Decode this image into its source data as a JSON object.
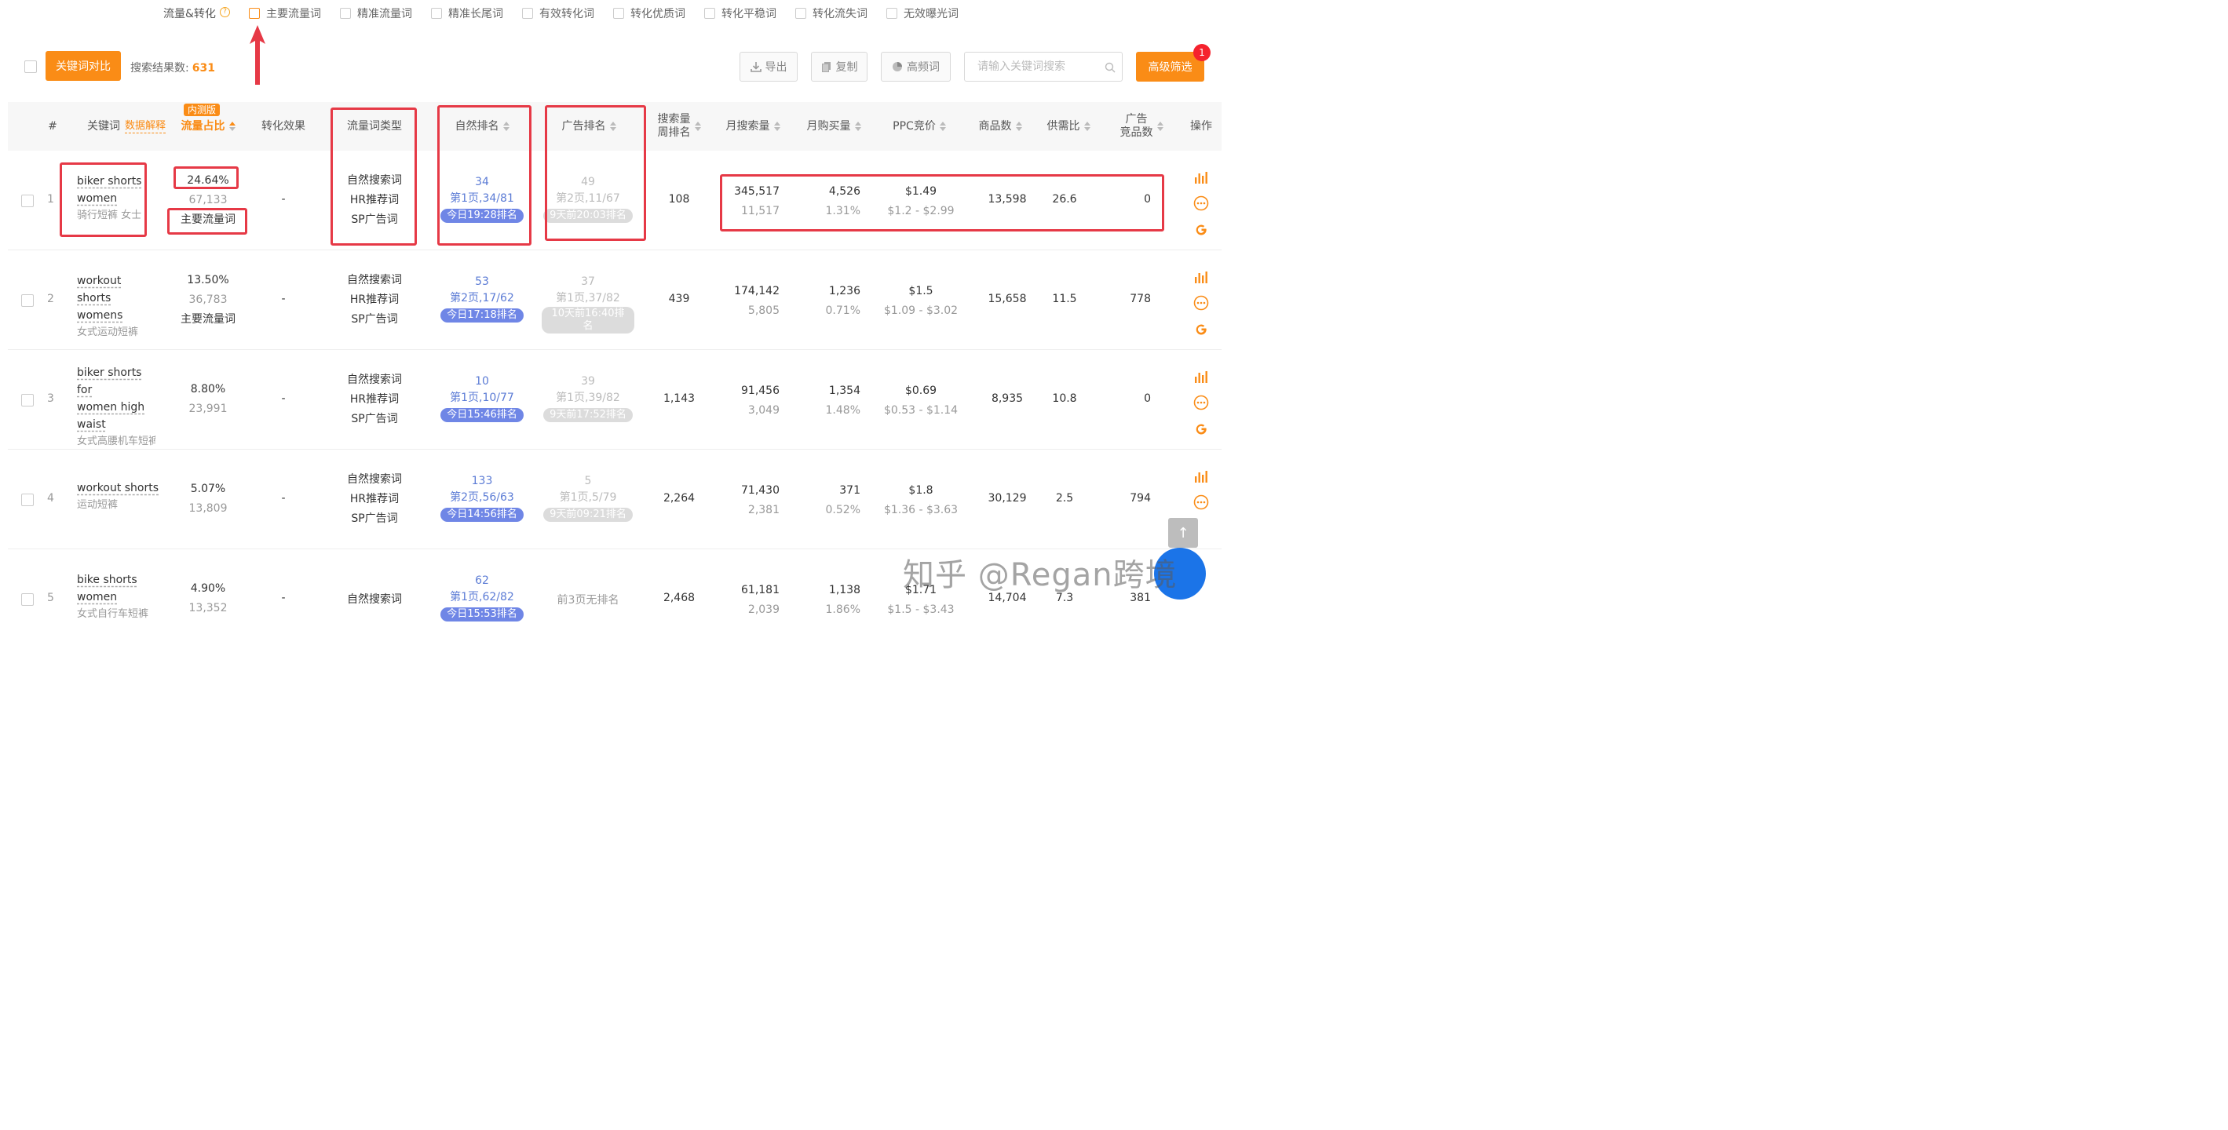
{
  "filters": {
    "title": "流量&转化",
    "help": "?",
    "options": [
      "主要流量词",
      "精准流量词",
      "精准长尾词",
      "有效转化词",
      "转化优质词",
      "转化平稳词",
      "转化流失词",
      "无效曝光词"
    ]
  },
  "toolbar": {
    "compare_label": "关键词对比",
    "result_label": "搜索结果数:",
    "result_count": "631",
    "export_label": "导出",
    "copy_label": "复制",
    "freq_label": "高频词",
    "search_placeholder": "请输入关键词搜索",
    "advanced_label": "高级筛选",
    "badge": "1"
  },
  "table": {
    "headers": {
      "index": "#",
      "keyword": "关键词",
      "data_explain": "数据解释",
      "beta": "内测版",
      "traffic_share": "流量占比",
      "conversion": "转化效果",
      "traffic_type": "流量词类型",
      "natural_rank": "自然排名",
      "ad_rank": "广告排名",
      "search_rank_1": "搜索量",
      "search_rank_2": "周排名",
      "monthly_search": "月搜索量",
      "monthly_purchase": "月购买量",
      "ppc": "PPC竞价",
      "products": "商品数",
      "supply_ratio": "供需比",
      "ad_products_1": "广告",
      "ad_products_2": "竞品数",
      "ops": "操作"
    },
    "rows": [
      {
        "idx": "1",
        "kw_en": [
          "biker shorts",
          "women"
        ],
        "kw_cn": "骑行短裤 女士",
        "share": "24.64%",
        "share_count": "67,133",
        "share_tag": "主要流量词",
        "conversion": "-",
        "types": [
          "自然搜索词",
          "HR推荐词",
          "SP广告词"
        ],
        "nat_rank": "34",
        "nat_page": "第1页,34/81",
        "nat_time": "今日19:28排名",
        "ad_rank": "49",
        "ad_page": "第2页,11/67",
        "ad_time": "9天前20:03排名",
        "search_week": "108",
        "monthly_search": "345,517",
        "monthly_search_sub": "11,517",
        "monthly_buy": "4,526",
        "monthly_buy_rate": "1.31%",
        "ppc": "$1.49",
        "ppc_range": "$1.2 - $2.99",
        "products": "13,598",
        "supply": "26.6",
        "ad_products": "0"
      },
      {
        "idx": "2",
        "kw_en": [
          "workout shorts",
          "womens"
        ],
        "kw_cn": "女式运动短裤",
        "share": "13.50%",
        "share_count": "36,783",
        "share_tag": "主要流量词",
        "conversion": "-",
        "types": [
          "自然搜索词",
          "HR推荐词",
          "SP广告词"
        ],
        "nat_rank": "53",
        "nat_page": "第2页,17/62",
        "nat_time": "今日17:18排名",
        "ad_rank": "37",
        "ad_page": "第1页,37/82",
        "ad_time": "10天前16:40排名",
        "search_week": "439",
        "monthly_search": "174,142",
        "monthly_search_sub": "5,805",
        "monthly_buy": "1,236",
        "monthly_buy_rate": "0.71%",
        "ppc": "$1.5",
        "ppc_range": "$1.09 - $3.02",
        "products": "15,658",
        "supply": "11.5",
        "ad_products": "778"
      },
      {
        "idx": "3",
        "kw_en": [
          "biker shorts for",
          "women high",
          "waist"
        ],
        "kw_cn": "女式高腰机车短裤",
        "share": "8.80%",
        "share_count": "23,991",
        "share_tag": "",
        "conversion": "-",
        "types": [
          "自然搜索词",
          "HR推荐词",
          "SP广告词"
        ],
        "nat_rank": "10",
        "nat_page": "第1页,10/77",
        "nat_time": "今日15:46排名",
        "ad_rank": "39",
        "ad_page": "第1页,39/82",
        "ad_time": "9天前17:52排名",
        "search_week": "1,143",
        "monthly_search": "91,456",
        "monthly_search_sub": "3,049",
        "monthly_buy": "1,354",
        "monthly_buy_rate": "1.48%",
        "ppc": "$0.69",
        "ppc_range": "$0.53 - $1.14",
        "products": "8,935",
        "supply": "10.8",
        "ad_products": "0"
      },
      {
        "idx": "4",
        "kw_en": [
          "workout shorts"
        ],
        "kw_cn": "运动短裤",
        "share": "5.07%",
        "share_count": "13,809",
        "share_tag": "",
        "conversion": "-",
        "types": [
          "自然搜索词",
          "HR推荐词",
          "SP广告词"
        ],
        "nat_rank": "133",
        "nat_page": "第2页,56/63",
        "nat_time": "今日14:56排名",
        "ad_rank": "5",
        "ad_page": "第1页,5/79",
        "ad_time": "9天前09:21排名",
        "search_week": "2,264",
        "monthly_search": "71,430",
        "monthly_search_sub": "2,381",
        "monthly_buy": "371",
        "monthly_buy_rate": "0.52%",
        "ppc": "$1.8",
        "ppc_range": "$1.36 - $3.63",
        "products": "30,129",
        "supply": "2.5",
        "ad_products": "794"
      },
      {
        "idx": "5",
        "kw_en": [
          "bike shorts",
          "women"
        ],
        "kw_cn": "女式自行车短裤",
        "share": "4.90%",
        "share_count": "13,352",
        "share_tag": "",
        "conversion": "-",
        "types": [
          "自然搜索词"
        ],
        "nat_rank": "62",
        "nat_page": "第1页,62/82",
        "nat_time": "今日15:53排名",
        "ad_none": "前3页无排名",
        "search_week": "2,468",
        "monthly_search": "61,181",
        "monthly_search_sub": "2,039",
        "monthly_buy": "1,138",
        "monthly_buy_rate": "1.86%",
        "ppc": "$1.71",
        "ppc_range": "$1.5 - $3.43",
        "products": "14,704",
        "supply": "7.3",
        "ad_products": "381"
      }
    ]
  },
  "scroll_top": "↑",
  "watermark": "知乎 @Regan跨境",
  "colors": {
    "accent": "#fa8c16",
    "annotation": "#e63946",
    "rank_blue": "#6f86e6"
  }
}
